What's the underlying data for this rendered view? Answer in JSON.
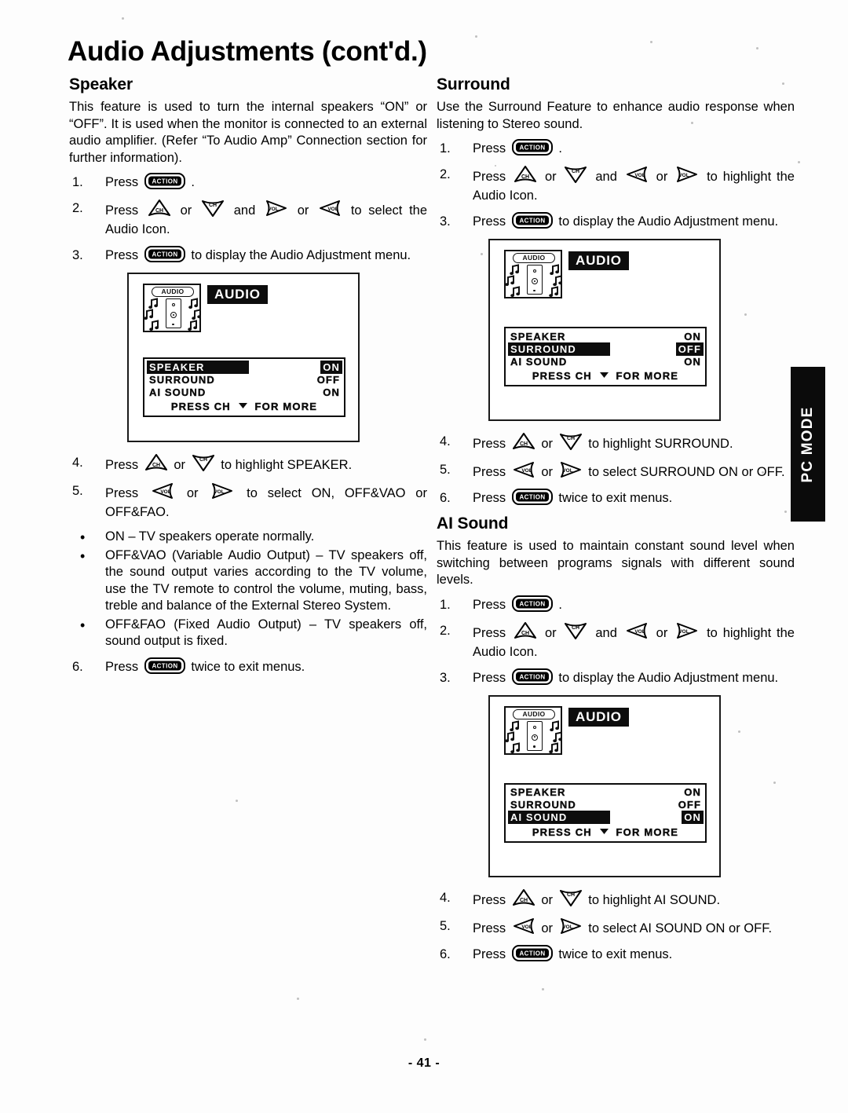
{
  "document": {
    "title": "Audio Adjustments (cont'd.)",
    "page_number": "- 41 -",
    "side_tab": "PC MODE"
  },
  "icons": {
    "action": "ACTION",
    "ch_up": "CH",
    "ch_down": "CH",
    "vol_left": "VOL",
    "vol_right": "VOL"
  },
  "osd": {
    "icon_label": "AUDIO",
    "title_badge": "AUDIO",
    "more_prefix": "PRESS",
    "more_ch": "CH",
    "more_suffix": "FOR MORE",
    "rows": {
      "speaker": "SPEAKER",
      "surround": "SURROUND",
      "ai_sound": "AI SOUND"
    },
    "values": {
      "speaker": "ON",
      "surround": "OFF",
      "ai_sound": "ON"
    }
  },
  "speaker": {
    "heading": "Speaker",
    "intro": "This feature is used to turn the internal speakers “ON” or “OFF”. It is used when the monitor is connected to an external audio amplifier. (Refer “To Audio Amp” Connection section for further information).",
    "step1_num": "1.",
    "step1_press": "Press",
    "step1_tail": ".",
    "step2_num": "2.",
    "step2_press": "Press",
    "step2_or1": "or",
    "step2_and": "and",
    "step2_or2": "or",
    "step2_tail": "to select the Audio Icon.",
    "step3_num": "3.",
    "step3_press": "Press",
    "step3_tail": "to display the Audio Adjustment menu.",
    "step4_num": "4.",
    "step4_press": "Press",
    "step4_or": "or",
    "step4_tail": "to highlight SPEAKER.",
    "step5_num": "5.",
    "step5_press": "Press",
    "step5_or": "or",
    "step5_tail": "to select ON, OFF&VAO or OFF&FAO.",
    "bullet1": "ON – TV speakers operate normally.",
    "bullet2": "OFF&VAO (Variable Audio Output) – TV speakers off, the sound output varies according to the TV volume, use the TV remote to control the volume, muting, bass, treble and balance of the External Stereo System.",
    "bullet3": "OFF&FAO (Fixed Audio Output) – TV speakers off, sound output is fixed.",
    "step6_num": "6.",
    "step6_press": "Press",
    "step6_tail": "twice to exit menus."
  },
  "surround": {
    "heading": "Surround",
    "intro": "Use the Surround Feature to enhance audio response when listening to Stereo sound.",
    "step1_num": "1.",
    "step1_press": "Press",
    "step1_tail": ".",
    "step2_num": "2.",
    "step2_press": "Press",
    "step2_or1": "or",
    "step2_and": "and",
    "step2_or2": "or",
    "step2_tail": "to highlight the Audio Icon.",
    "step3_num": "3.",
    "step3_press": "Press",
    "step3_tail": "to display the Audio Adjustment menu.",
    "step4_num": "4.",
    "step4_press": "Press",
    "step4_or": "or",
    "step4_tail": "to highlight SURROUND.",
    "step5_num": "5.",
    "step5_press": "Press",
    "step5_or": "or",
    "step5_tail": "to select SURROUND ON or OFF.",
    "step6_num": "6.",
    "step6_press": "Press",
    "step6_tail": "twice to exit menus."
  },
  "ai_sound": {
    "heading": "AI Sound",
    "intro": "This feature is used to maintain constant sound level when switching between programs signals with different sound levels.",
    "step1_num": "1.",
    "step1_press": "Press",
    "step1_tail": ".",
    "step2_num": "2.",
    "step2_press": "Press",
    "step2_or1": "or",
    "step2_and": "and",
    "step2_or2": "or",
    "step2_tail": "to highlight the Audio Icon.",
    "step3_num": "3.",
    "step3_press": "Press",
    "step3_tail": "to display the Audio Adjustment menu.",
    "step4_num": "4.",
    "step4_press": "Press",
    "step4_or": "or",
    "step4_tail": "to highlight AI SOUND.",
    "step5_num": "5.",
    "step5_press": "Press",
    "step5_or": "or",
    "step5_tail": "to select AI SOUND ON or OFF.",
    "step6_num": "6.",
    "step6_press": "Press",
    "step6_tail": "twice to exit menus."
  }
}
